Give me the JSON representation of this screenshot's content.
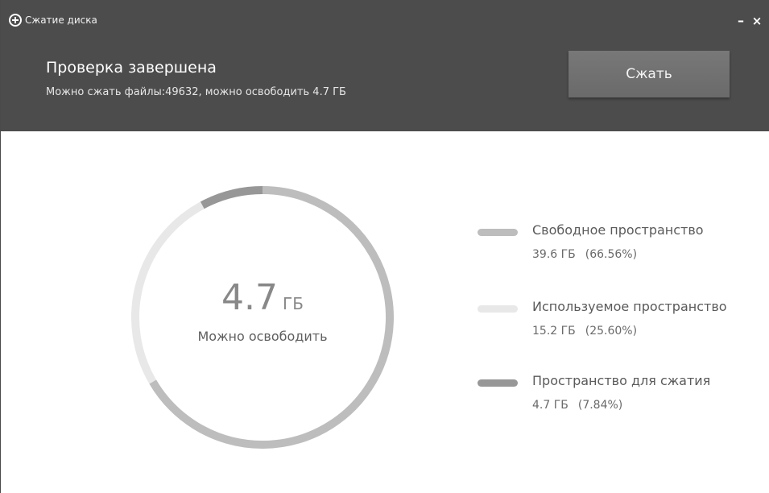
{
  "window": {
    "title": "Сжатие диска",
    "app_icon": "plus-circle-icon",
    "minimize_label": "–",
    "close_label": "×"
  },
  "header": {
    "title": "Проверка завершена",
    "subtitle": "Можно сжать файлы:49632, можно освободить 4.7 ГБ",
    "compress_button": "Сжать",
    "background_color": "#4c4c4c"
  },
  "summary": {
    "value": "4.7",
    "unit": "ГБ",
    "caption": "Можно освободить"
  },
  "legend": [
    {
      "label": "Свободное пространство",
      "size": "39.6 ГБ",
      "percent": "(66.56%)",
      "color": "#bdbdbd"
    },
    {
      "label": "Используемое пространство",
      "size": "15.2 ГБ",
      "percent": "(25.60%)",
      "color": "#e8e8e8"
    },
    {
      "label": "Пространство для сжатия",
      "size": "4.7 ГБ",
      "percent": "(7.84%)",
      "color": "#979797"
    }
  ],
  "chart_data": {
    "type": "pie",
    "categories": [
      "Свободное пространство",
      "Используемое пространство",
      "Пространство для сжатия"
    ],
    "values": [
      66.56,
      25.6,
      7.84
    ],
    "sizes_gb": [
      39.6,
      15.2,
      4.7
    ],
    "colors": [
      "#bdbdbd",
      "#e8e8e8",
      "#979797"
    ],
    "style": "donut",
    "legend_position": "right"
  }
}
